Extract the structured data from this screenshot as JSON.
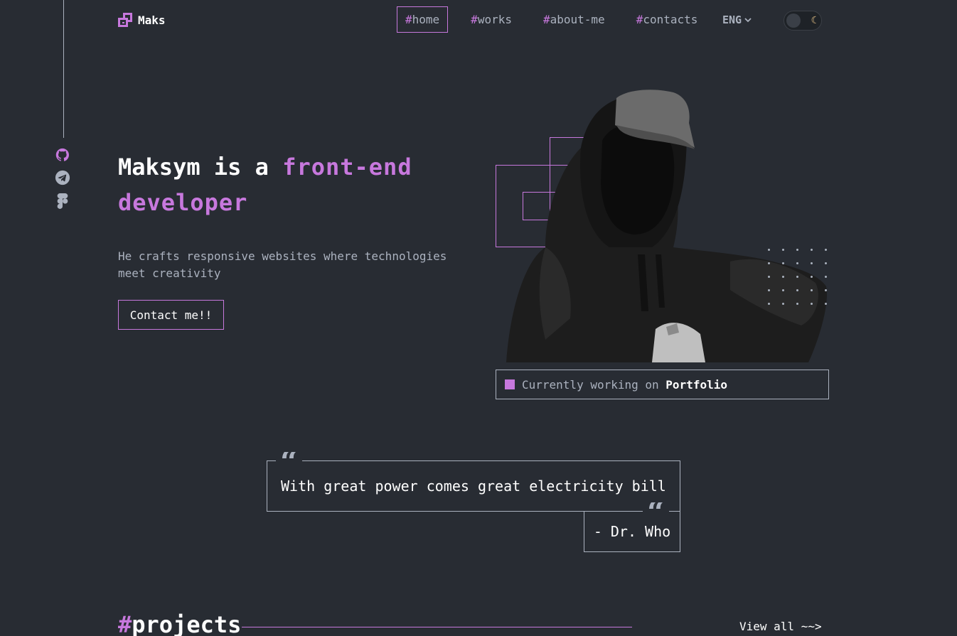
{
  "header": {
    "logo_text": "Maks",
    "nav": [
      {
        "hash": "#",
        "label": "home",
        "active": true
      },
      {
        "hash": "#",
        "label": "works"
      },
      {
        "hash": "#",
        "label": "about-me"
      },
      {
        "hash": "#",
        "label": "contacts"
      }
    ],
    "language": "ENG",
    "theme_icon": "moon-icon"
  },
  "social": [
    "github-icon",
    "telegram-icon",
    "figma-icon"
  ],
  "hero": {
    "title_prefix": "Maksym is a ",
    "title_accent_1": "front-end",
    "title_accent_2": "developer",
    "subtitle": "He crafts responsive websites where technologies meet creativity",
    "cta": "Contact me!!",
    "status_prefix": "Currently working on",
    "status_project": "Portfolio"
  },
  "quote": {
    "text": "With great power comes great electricity bill",
    "author": "- Dr. Who"
  },
  "projects": {
    "hash": "#",
    "title": "projects",
    "view_all": "View all ~~>"
  },
  "colors": {
    "background": "#282c33",
    "accent": "#c778dd",
    "text": "#abb2bf"
  }
}
